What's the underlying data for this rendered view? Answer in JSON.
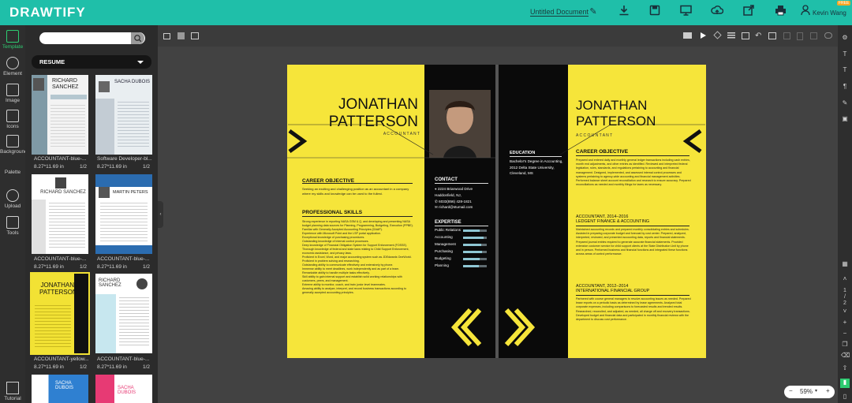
{
  "app": {
    "logo": "DRAWTIFY",
    "document_title": "Untitled Document",
    "free_badge": "FREE",
    "user_name": "Kevin Wang"
  },
  "left_rail": {
    "items": [
      {
        "label": "Template",
        "active": true
      },
      {
        "label": "Element"
      },
      {
        "label": "Image"
      },
      {
        "label": "Icons"
      },
      {
        "label": "Background"
      },
      {
        "label": "Palette"
      },
      {
        "label": "Upload"
      },
      {
        "label": "Tools"
      }
    ],
    "tutorial": "Tutorial"
  },
  "panel": {
    "category": "RESUME",
    "templates": [
      {
        "name": "ACCOUNTANT-blue-...",
        "size": "8.27*11.69 in",
        "pages": "1/2",
        "title": "RICHARD SANCHEZ"
      },
      {
        "name": "Software Developer-bl...",
        "size": "8.27*11.69 in",
        "pages": "1/2",
        "title": "SACHA DUBOIS"
      },
      {
        "name": "ACCOUNTANT-blue-...",
        "size": "8.27*11.69 in",
        "pages": "1/2",
        "title": "RICHARD SANCHEZ"
      },
      {
        "name": "ACCOUNTANT-blue-...",
        "size": "8.27*11.69 in",
        "pages": "1/2",
        "title": "MARTIN PETERS"
      },
      {
        "name": "ACCOUNTANT-yellow...",
        "size": "8.27*11.69 in",
        "pages": "1/2",
        "title": "JONATHAN PATTERSON"
      },
      {
        "name": "ACCOUNTANT-blue-...",
        "size": "8.27*11.69 in",
        "pages": "1/2",
        "title": "RICHARD SANCHEZ"
      },
      {
        "title": "SACHA DUBOIS"
      },
      {
        "title": "SACHA DUBOIS"
      }
    ]
  },
  "page_nav": {
    "current": "1",
    "sep": "/",
    "total": "2"
  },
  "zoom": {
    "value": "59%",
    "minus": "−",
    "plus": "+"
  },
  "resume": {
    "first_name": "JONATHAN",
    "last_name": "PATTERSON",
    "role": "A C C O U N T A N T",
    "objective_heading": "CAREER OBJECTIVE",
    "objective_text": "Seeking an exciting and challenging position as an accountant in a company where my skills and knowledge can be used to the fullest.",
    "skills_heading": "PROFESSIONAL SKILLS",
    "skills": [
      "Strong experience in reporting NASA GSM & Q, and developing and presenting NASA budget planning data sources for Planning, Programming, Budgeting, Execution (PPBE).",
      "Familiar with Generally Accepted Accounting Principles (GAAP).",
      "Experience with Microsoft Point and the LSP portal application.",
      "Exceptional knowledge of purchasing procedures.",
      "Outstanding knowledge of internal control processes.",
      "Deep knowledge of Financial Obligation System for Support Enforcement (FOSSE).",
      "Thorough knowledge of federal and state laws relating to Child Support Enforcement, economic assistance, and privacy laws.",
      "Proficient in Excel, Word, and major accounting system such as JDEdwards OneWorld.",
      "Proficient in problem solving and researching.",
      "Outstanding ability to communicate effectively and extensively by phone.",
      "Immense ability to meet deadlines, work independently and as part of a team.",
      "Remarkable ability to handle multiple tasks effectively.",
      "Skill ability to gain internal support and establish solid working relationships with customers, peers, and management.",
      "Extreme ability to monitor, coach, and train junior level teammates.",
      "Amazing ability to analyze, interpret, and record business transactions according to generally accepted accounting principles."
    ],
    "contact_heading": "CONTACT",
    "contact": [
      {
        "icon": "location-icon",
        "text": "2224 Briarwood Drive Haddonfield, NJ,"
      },
      {
        "icon": "phone-icon",
        "text": "6033(856) 428-1821"
      },
      {
        "icon": "email-icon",
        "text": "richard@stumail.com"
      }
    ],
    "expertise_heading": "EXPERTISE",
    "expertise": [
      {
        "name": "Public Relations",
        "level": 0.7
      },
      {
        "name": "Accounting",
        "level": 0.85
      },
      {
        "name": "Management",
        "level": 0.75
      },
      {
        "name": "Purchasing",
        "level": 0.8
      },
      {
        "name": "Budgeting",
        "level": 0.7
      },
      {
        "name": "Planning",
        "level": 0.65
      }
    ],
    "education_heading": "EDUCATION",
    "education": "Bachelor's Degree in Accounting, 2012 Delta State University, Cleveland, MS",
    "objective_text_2": "Prepared and entered daily and monthly general ledger transactions including cash entries, month end adjustments, and other entries as identified. Reviewed and interpreted federal legislation, rules, standards, and regulations pertaining to accounting and financial management. Designed, implemented, and assessed internal control processes and systems pertaining to agency-wide accounting and financial management activities. Performed balance sheet account reconciliation and research to ensure accuracy. Prepared reconciliations as needed and monthly filings for taxes as necessary.",
    "jobs": [
      {
        "title": "ACCOUNTANT, 2014–2016",
        "company": "LEDGENT FINANCE & ACCOUNTING",
        "text": "Maintained accounting records and prepared monthly consolidating entries and schedules. Assisted in preparing corporate budget and forecast by cost center. Prepared, analyzed, interpreted, reviewed, and presented accounting data, reports and financial statements. Prepared journal entries required to generate accurate financial statements. Provided extensive customer service for child support clients at the State Distribution Unit by phone and in person. Performed business and financial functions and integrated these functions across areas of control performance."
      },
      {
        "title": "ACCOUNTANT, 2012–2014",
        "company": "INTERNATIONAL FINANCIAL GROUP",
        "text": "Partnered with course general managers to resolve accounting issues as needed. Prepared lease reports on a periodic basis as determined by lease agreements. Analyzed total corporate expenses, including comparisons to forecasted results and trended results. Researched, reconciled, and adjusted, as needed, all charge off and recovery transactions. Developed budget and financial data and participated in monthly financial reviews with the department to discuss cost performance."
      }
    ]
  }
}
